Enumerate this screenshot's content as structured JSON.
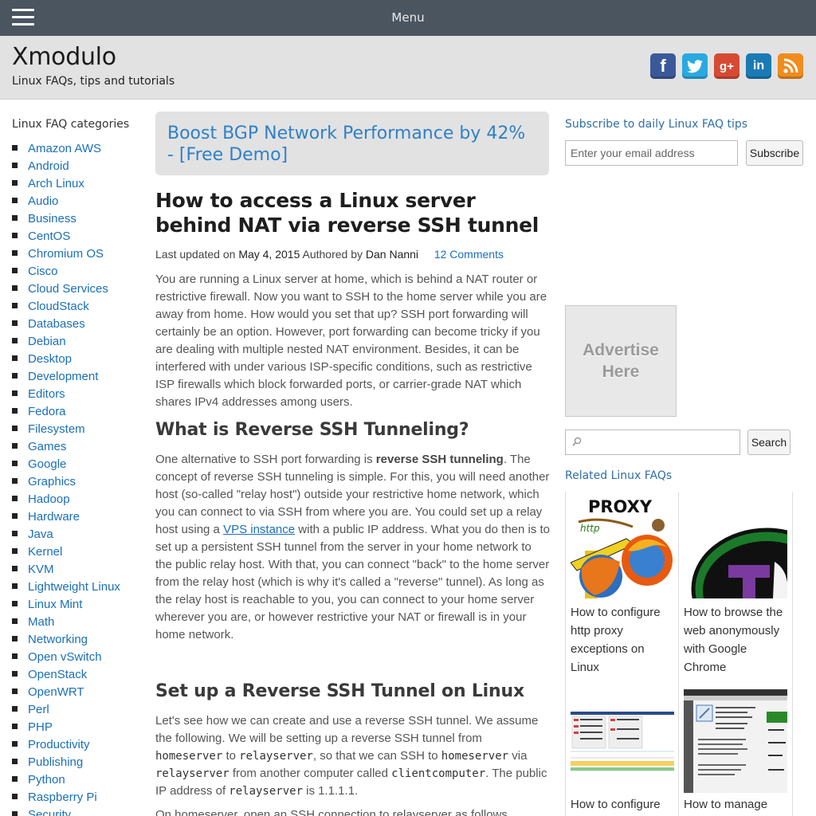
{
  "topbar": {
    "menu_label": "Menu"
  },
  "header": {
    "site_title": "Xmodulo",
    "tagline": "Linux FAQs, tips and tutorials",
    "social": [
      {
        "icon": "facebook-icon",
        "glyph": "f",
        "color": "#3b5998"
      },
      {
        "icon": "twitter-icon",
        "glyph": "t",
        "color": "#29a9e0"
      },
      {
        "icon": "google-plus-icon",
        "glyph": "g+",
        "color": "#d64a34"
      },
      {
        "icon": "linkedin-icon",
        "glyph": "in",
        "color": "#1b7ab4"
      },
      {
        "icon": "rss-icon",
        "glyph": "rss",
        "color": "#f08c1e"
      }
    ]
  },
  "left_sidebar": {
    "heading": "Linux FAQ categories",
    "categories": [
      "Amazon AWS",
      "Android",
      "Arch Linux",
      "Audio",
      "Business",
      "CentOS",
      "Chromium OS",
      "Cisco",
      "Cloud Services",
      "CloudStack",
      "Databases",
      "Debian",
      "Desktop",
      "Development",
      "Editors",
      "Fedora",
      "Filesystem",
      "Games",
      "Google",
      "Graphics",
      "Hadoop",
      "Hardware",
      "Java",
      "Kernel",
      "KVM",
      "Lightweight Linux",
      "Linux Mint",
      "Math",
      "Networking",
      "Open vSwitch",
      "OpenStack",
      "OpenWRT",
      "Perl",
      "PHP",
      "Productivity",
      "Publishing",
      "Python",
      "Raspberry Pi",
      "Security"
    ]
  },
  "main": {
    "promo": "Boost BGP Network Performance by 42% - [Free Demo]",
    "title": "How to access a Linux server behind NAT via reverse SSH tunnel",
    "meta": {
      "updated_label": "Last updated on",
      "date": "May 4, 2015",
      "author_label": "Authored by",
      "author": "Dan Nanni",
      "comments": "12 Comments"
    },
    "p1": "You are running a Linux server at home, which is behind a NAT router or restrictive firewall. Now you want to SSH to the home server while you are away from home. How would you set that up? SSH port forwarding will certainly be an option. However, port forwarding can become tricky if you are dealing with multiple nested NAT environment. Besides, it can be interfered with under various ISP-specific conditions, such as restrictive ISP firewalls which block forwarded ports, or carrier-grade NAT which shares IPv4 addresses among users.",
    "h2_1": "What is Reverse SSH Tunneling?",
    "p2_a": "One alternative to SSH port forwarding is ",
    "p2_bold": "reverse SSH tunneling",
    "p2_b": ". The concept of reverse SSH tunneling is simple. For this, you will need another host (so-called \"relay host\") outside your restrictive home network, which you can connect to via SSH from where you are. You could set up a relay host using a ",
    "p2_link": "VPS instance",
    "p2_c": " with a public IP address. What you do then is to set up a persistent SSH tunnel from the server in your home network to the public relay host. With that, you can connect \"back\" to the home server from the relay host (which is why it's called a \"reverse\" tunnel). As long as the relay host is reachable to you, you can connect to your home server wherever you are, or however restrictive your NAT or firewall is in your home network.",
    "h2_2": "Set up a Reverse SSH Tunnel on Linux",
    "p3_a": "Let's see how we can create and use a reverse SSH tunnel. We assume the following. We will be setting up a reverse SSH tunnel from ",
    "p3_code1": "homeserver",
    "p3_b": " to ",
    "p3_code2": "relayserver",
    "p3_c": ", so that we can SSH to ",
    "p3_code3": "homeserver",
    "p3_d": " via ",
    "p3_code4": "relayserver",
    "p3_e": " from another computer called ",
    "p3_code5": "clientcomputer",
    "p3_f": ". The public IP address of ",
    "p3_code6": "relayserver",
    "p3_g": " is 1.1.1.1.",
    "p4": "On homeserver, open an SSH connection to relayserver as follows."
  },
  "right_sidebar": {
    "subscribe_heading": "Subscribe to daily Linux FAQ tips",
    "email_placeholder": "Enter your email address",
    "subscribe_button": "Subscribe",
    "advert_text": "Advertise Here",
    "search_button": "Search",
    "related_heading": "Related Linux FAQs",
    "related": [
      {
        "title": "How to configure http proxy exceptions on Linux",
        "thumb_text": "PROXY"
      },
      {
        "title": "How to browse the web anonymously with Google Chrome",
        "thumb_text": ""
      },
      {
        "title": "How to configure",
        "thumb_text": ""
      },
      {
        "title": "How to manage",
        "thumb_text": ""
      }
    ]
  }
}
